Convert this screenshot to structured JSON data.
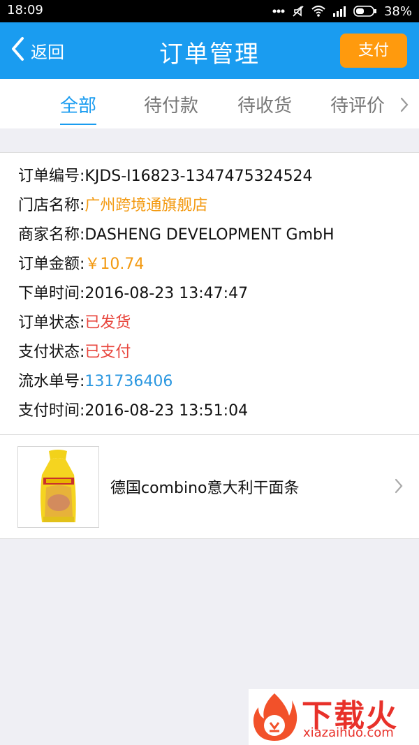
{
  "statusbar": {
    "time": "18:09",
    "battery": "38%"
  },
  "navbar": {
    "back_label": "返回",
    "title": "订单管理",
    "pay_button": "支付"
  },
  "tabs": [
    {
      "label": "全部",
      "active": true
    },
    {
      "label": "待付款",
      "active": false
    },
    {
      "label": "待收货",
      "active": false
    },
    {
      "label": "待评价",
      "active": false
    }
  ],
  "order": {
    "order_no_label": "订单编号:",
    "order_no": "KJDS-I16823-1347475324524",
    "store_label": "门店名称:",
    "store": "广州跨境通旗舰店",
    "merchant_label": "商家名称:",
    "merchant": "DASHENG DEVELOPMENT GmbH",
    "amount_label": "订单金额:",
    "amount": "￥10.74",
    "order_time_label": "下单时间:",
    "order_time": "2016-08-23 13:47:47",
    "order_status_label": "订单状态:",
    "order_status": "已发货",
    "pay_status_label": "支付状态:",
    "pay_status": "已支付",
    "serial_label": "流水单号:",
    "serial": "131736406",
    "pay_time_label": "支付时间:",
    "pay_time": "2016-08-23 13:51:04"
  },
  "product": {
    "name": "德国combino意大利干面条"
  },
  "watermark": {
    "brand": "下载火",
    "url": "xiazaihuo.com"
  },
  "colors": {
    "accent": "#1a9cf0",
    "pay_button": "#ff9a0d",
    "orange": "#f39a12",
    "red": "#e8453c",
    "blue": "#2a97e0"
  }
}
